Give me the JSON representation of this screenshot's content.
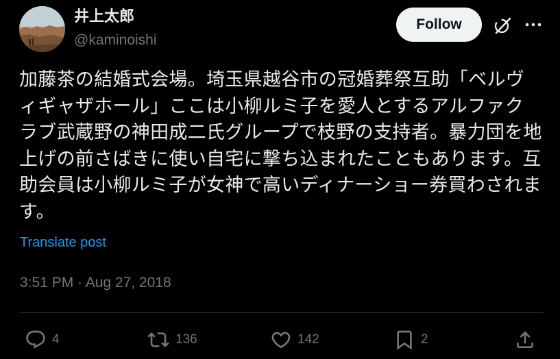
{
  "user": {
    "display_name": "井上太郎",
    "handle": "@kaminoishi"
  },
  "header": {
    "follow_label": "Follow",
    "grok_icon": "grok-icon",
    "more_icon": "more-dots-icon"
  },
  "tweet": {
    "lines": [
      "加藤茶の結婚式会場。埼玉県越谷市の冠婚葬祭互助「ベルヴ",
      "ィギャザホール」ここは小柳ルミ子を愛人とするアルファク",
      "ラブ武蔵野の神田成二氏グループで枝野の支持者。暴力団を地",
      "上げの前さばきに使い自宅に撃ち込まれたこともあります。互",
      "助会員は小柳ルミ子が女神で高いディナーショー券買わされま",
      "す。"
    ],
    "translate_label": "Translate post",
    "timestamp": "3:51 PM · Aug 27, 2018"
  },
  "actions": {
    "replies": "4",
    "reposts": "136",
    "likes": "142",
    "bookmarks": "2"
  },
  "colors": {
    "background": "#000000",
    "text": "#e7e9ea",
    "muted": "#71767b",
    "link": "#1d9bf0",
    "follow_bg": "#eff3f4",
    "divider": "#2f3336"
  }
}
